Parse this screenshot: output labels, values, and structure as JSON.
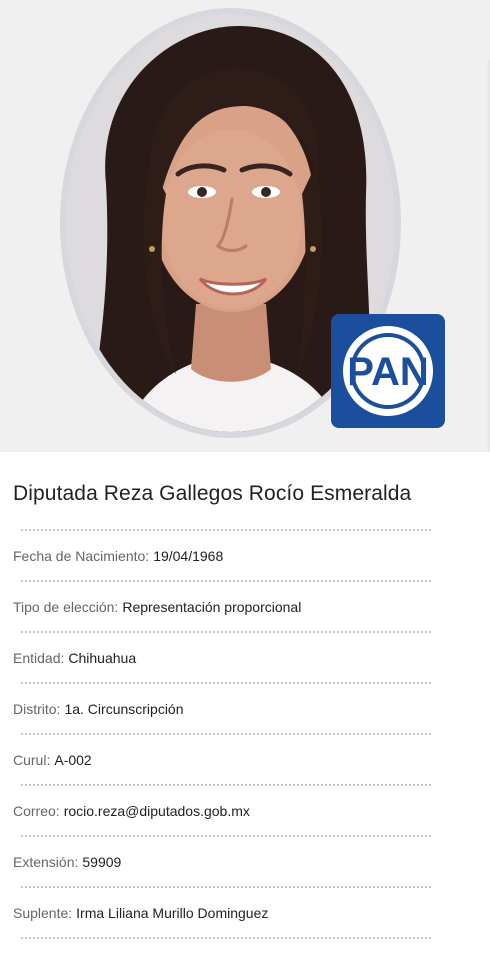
{
  "party": {
    "logo_text": "PAN",
    "color": "#1b4e9c"
  },
  "profile": {
    "name": "Diputada Reza Gallegos Rocío Esmeralda",
    "fields": [
      {
        "label": "Fecha de Nacimiento:",
        "value": "19/04/1968"
      },
      {
        "label": "Tipo de elección:",
        "value": "Representación proporcional"
      },
      {
        "label": "Entidad:",
        "value": "Chihuahua"
      },
      {
        "label": "Distrito:",
        "value": "1a. Circunscripción"
      },
      {
        "label": "Curul:",
        "value": "A-002"
      },
      {
        "label": "Correo:",
        "value": "rocio.reza@diputados.gob.mx"
      },
      {
        "label": "Extensión:",
        "value": "59909"
      },
      {
        "label": "Suplente:",
        "value": "Irma Liliana Murillo Dominguez"
      }
    ]
  }
}
